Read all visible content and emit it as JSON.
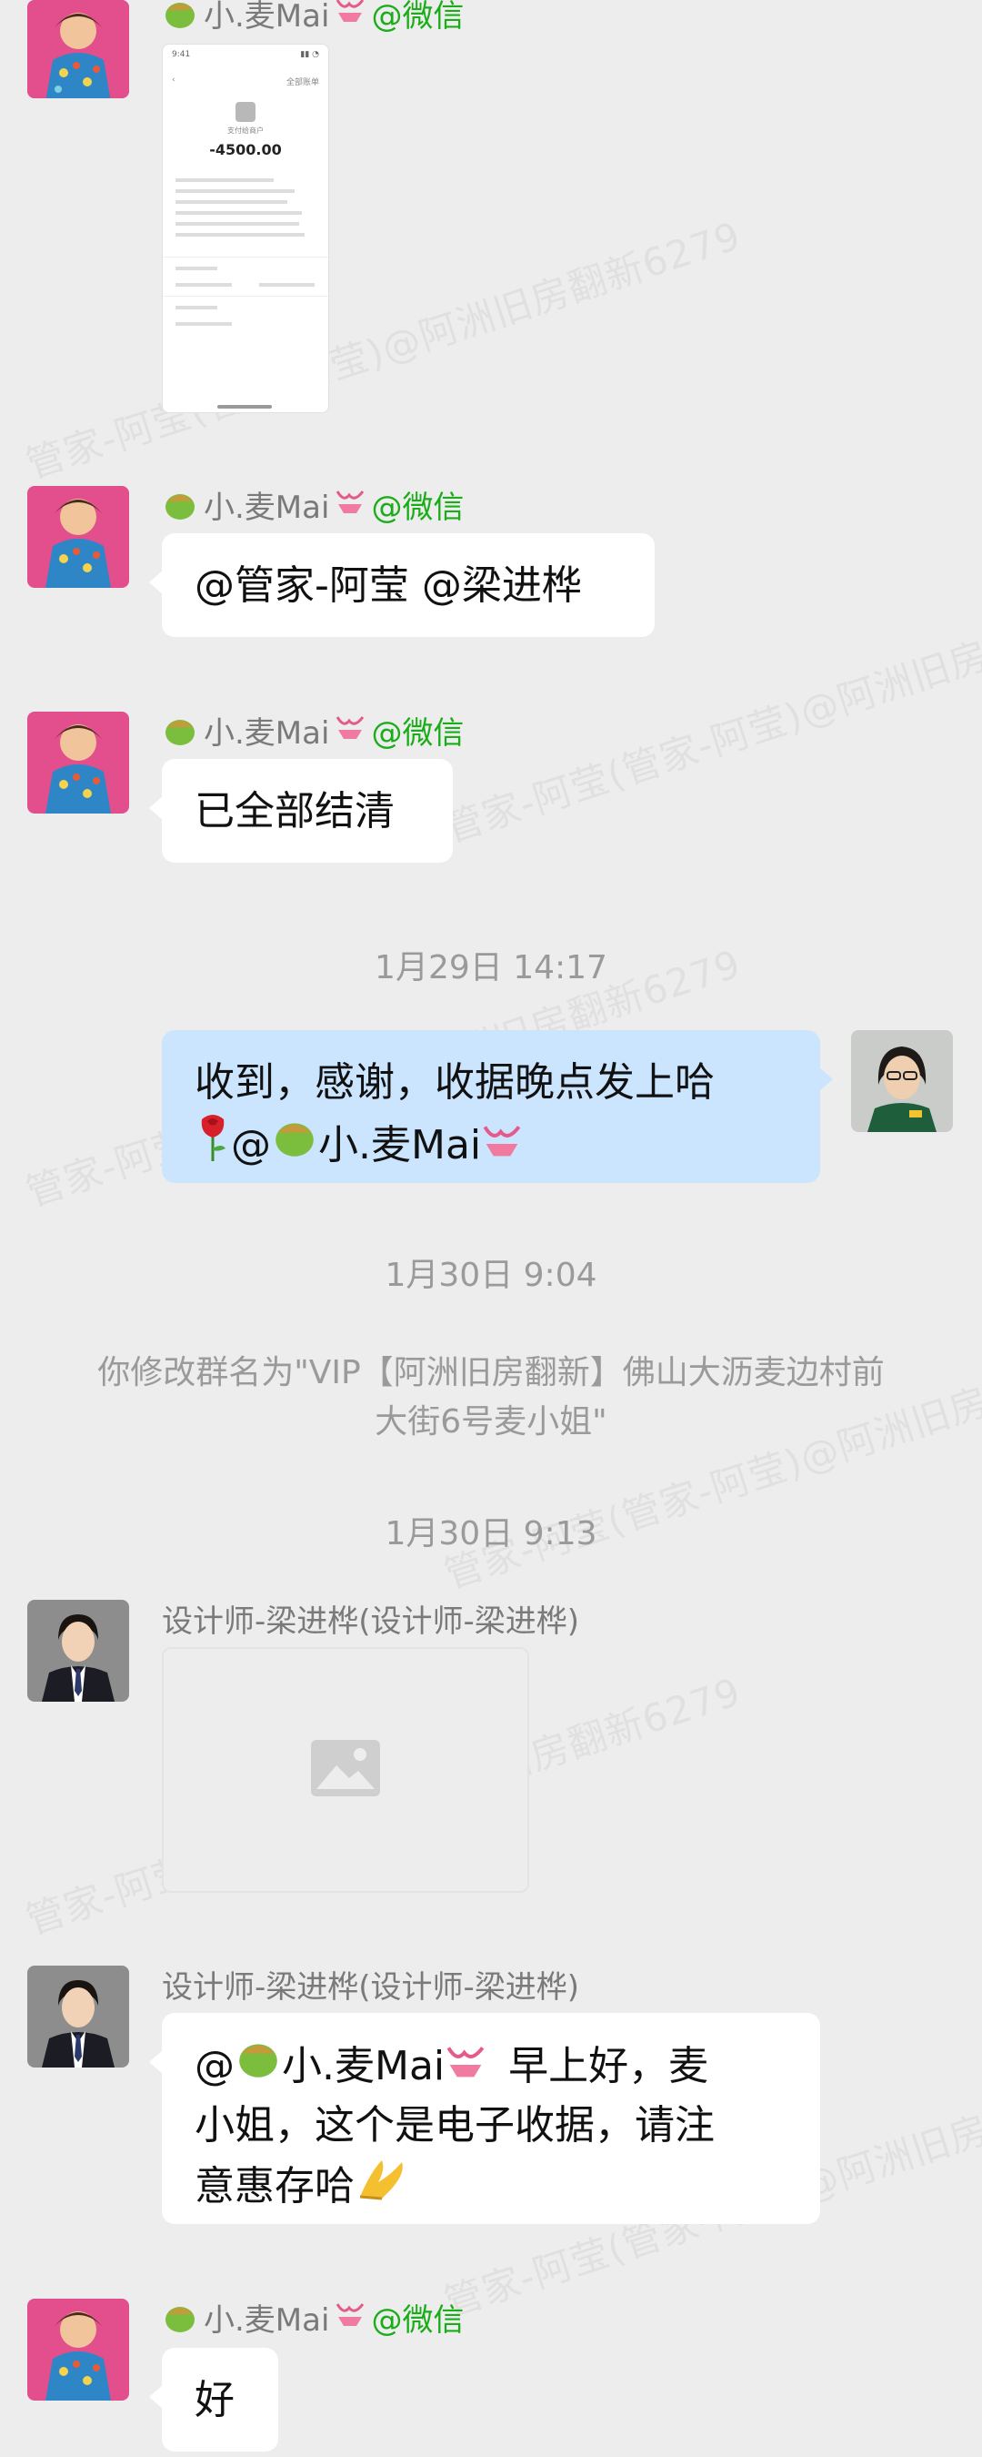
{
  "watermark": "管家-阿莹(管家-阿莹)@阿洲旧房翻新6279",
  "messages": [
    {
      "sender": "小.麦Mai",
      "sender_tag": "@微信",
      "type": "image",
      "receipt": {
        "amount": "-4500.00"
      }
    },
    {
      "sender": "小.麦Mai",
      "sender_tag": "@微信",
      "type": "text",
      "text": "@管家-阿莹 @梁进桦"
    },
    {
      "sender": "小.麦Mai",
      "sender_tag": "@微信",
      "type": "text",
      "text": "已全部结清"
    },
    {
      "type": "time",
      "text": "1月29日 14:17"
    },
    {
      "type": "self-text",
      "line1": "收到，感谢，收据晚点发上哈",
      "line2_prefix": "@",
      "line2_name": "小.麦Mai"
    },
    {
      "type": "time",
      "text": "1月30日 9:04"
    },
    {
      "type": "system",
      "text": "你修改群名为\"VIP【阿洲旧房翻新】佛山大沥麦边村前大街6号麦小姐\""
    },
    {
      "type": "time",
      "text": "1月30日 9:13"
    },
    {
      "sender": "设计师-梁进桦(设计师-梁进桦)",
      "type": "image-placeholder"
    },
    {
      "sender": "设计师-梁进桦(设计师-梁进桦)",
      "type": "text",
      "mention": "@",
      "mention_name": "小.麦Mai",
      "line1_rest": "早上好，麦",
      "line2": "小姐，这个是电子收据，请注",
      "line3": "意惠存哈"
    },
    {
      "sender": "小.麦Mai",
      "sender_tag": "@微信",
      "type": "text",
      "text": "好"
    }
  ],
  "icons": {
    "avatar_mai": "avatar-photo",
    "avatar_self": "avatar-photo",
    "avatar_designer": "avatar-photo",
    "rose": "rose-icon",
    "pray": "pray-hands-icon",
    "image_placeholder": "image-icon"
  }
}
